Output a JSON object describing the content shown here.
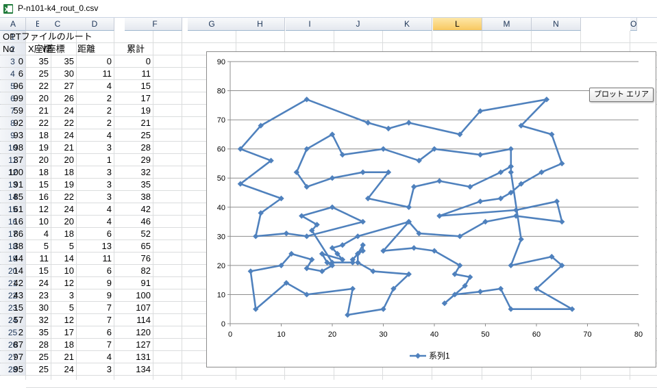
{
  "window": {
    "title": "P-n101-k4_rout_0.csv"
  },
  "columns": [
    "A",
    "B",
    "C",
    "D",
    "E",
    "F",
    "G",
    "H",
    "I",
    "J",
    "K",
    "L",
    "M",
    "N",
    "O"
  ],
  "selected_column": "L",
  "rows": [
    [
      "OPTファイルのルート",
      "",
      "",
      "",
      ""
    ],
    [
      "No",
      "X座標",
      "Y座標",
      "距離",
      "累計"
    ],
    [
      "0",
      "35",
      "35",
      "0",
      "0"
    ],
    [
      "6",
      "25",
      "30",
      "11",
      "11"
    ],
    [
      "96",
      "22",
      "27",
      "4",
      "15"
    ],
    [
      "99",
      "20",
      "26",
      "2",
      "17"
    ],
    [
      "59",
      "21",
      "24",
      "2",
      "19"
    ],
    [
      "92",
      "22",
      "22",
      "2",
      "21"
    ],
    [
      "93",
      "18",
      "24",
      "4",
      "25"
    ],
    [
      "98",
      "19",
      "21",
      "3",
      "28"
    ],
    [
      "37",
      "20",
      "20",
      "1",
      "29"
    ],
    [
      "100",
      "18",
      "18",
      "3",
      "32"
    ],
    [
      "91",
      "15",
      "19",
      "3",
      "35"
    ],
    [
      "85",
      "16",
      "22",
      "3",
      "38"
    ],
    [
      "61",
      "12",
      "24",
      "4",
      "42"
    ],
    [
      "16",
      "10",
      "20",
      "4",
      "46"
    ],
    [
      "86",
      "4",
      "18",
      "6",
      "52"
    ],
    [
      "38",
      "5",
      "5",
      "13",
      "65"
    ],
    [
      "44",
      "11",
      "14",
      "11",
      "76"
    ],
    [
      "14",
      "15",
      "10",
      "6",
      "82"
    ],
    [
      "42",
      "24",
      "12",
      "9",
      "91"
    ],
    [
      "43",
      "23",
      "3",
      "9",
      "100"
    ],
    [
      "15",
      "30",
      "5",
      "7",
      "107"
    ],
    [
      "57",
      "32",
      "12",
      "7",
      "114"
    ],
    [
      "2",
      "35",
      "17",
      "6",
      "120"
    ],
    [
      "87",
      "28",
      "18",
      "7",
      "127"
    ],
    [
      "97",
      "25",
      "21",
      "4",
      "131"
    ],
    [
      "95",
      "25",
      "24",
      "3",
      "134"
    ]
  ],
  "row_numbers": [
    "1",
    "2",
    "3",
    "4",
    "5",
    "6",
    "7",
    "8",
    "9",
    "10",
    "11",
    "12",
    "13",
    "14",
    "15",
    "16",
    "17",
    "18",
    "19",
    "20",
    "21",
    "22",
    "23",
    "24",
    "25",
    "26",
    "27",
    "28"
  ],
  "tooltip": "プロット エリア",
  "chart_data": {
    "type": "scatter",
    "title": "",
    "xlabel": "",
    "ylabel": "",
    "xlim": [
      0,
      80
    ],
    "ylim": [
      0,
      90
    ],
    "xticks": [
      "0",
      "10",
      "20",
      "30",
      "40",
      "50",
      "60",
      "70",
      "80"
    ],
    "yticks": [
      "0",
      "10",
      "20",
      "30",
      "40",
      "50",
      "60",
      "70",
      "80",
      "90"
    ],
    "grid": "horizontal",
    "legend": "bottom",
    "color": "#4f81bd",
    "series": [
      {
        "name": "系列1",
        "points": [
          [
            35,
            35
          ],
          [
            25,
            30
          ],
          [
            22,
            27
          ],
          [
            20,
            26
          ],
          [
            21,
            24
          ],
          [
            22,
            22
          ],
          [
            18,
            24
          ],
          [
            19,
            21
          ],
          [
            20,
            20
          ],
          [
            18,
            18
          ],
          [
            15,
            19
          ],
          [
            16,
            22
          ],
          [
            12,
            24
          ],
          [
            10,
            20
          ],
          [
            4,
            18
          ],
          [
            5,
            5
          ],
          [
            11,
            14
          ],
          [
            15,
            10
          ],
          [
            24,
            12
          ],
          [
            23,
            3
          ],
          [
            30,
            5
          ],
          [
            32,
            12
          ],
          [
            35,
            17
          ],
          [
            28,
            18
          ],
          [
            25,
            21
          ],
          [
            25,
            24
          ],
          [
            26,
            27
          ],
          [
            26,
            25
          ],
          [
            25,
            24
          ],
          [
            24,
            22
          ],
          [
            24,
            21
          ],
          [
            20,
            21
          ],
          [
            16,
            32
          ],
          [
            17,
            34
          ],
          [
            14,
            37
          ],
          [
            20,
            40
          ],
          [
            26,
            35
          ],
          [
            15,
            30
          ],
          [
            11,
            31
          ],
          [
            5,
            30
          ],
          [
            6,
            38
          ],
          [
            10,
            43
          ],
          [
            2,
            48
          ],
          [
            8,
            56
          ],
          [
            2,
            60
          ],
          [
            6,
            68
          ],
          [
            15,
            77
          ],
          [
            27,
            69
          ],
          [
            31,
            67
          ],
          [
            35,
            69
          ],
          [
            45,
            65
          ],
          [
            49,
            73
          ],
          [
            62,
            77
          ],
          [
            57,
            68
          ],
          [
            63,
            65
          ],
          [
            65,
            55
          ],
          [
            61,
            52
          ],
          [
            57,
            48
          ],
          [
            55,
            45
          ],
          [
            53,
            43
          ],
          [
            49,
            42
          ],
          [
            41,
            37
          ],
          [
            56,
            39
          ],
          [
            64,
            42
          ],
          [
            65,
            35
          ],
          [
            56,
            37
          ],
          [
            50,
            35
          ],
          [
            45,
            30
          ],
          [
            37,
            31
          ],
          [
            35,
            35
          ],
          [
            30,
            25
          ],
          [
            36,
            26
          ],
          [
            40,
            25
          ],
          [
            45,
            20
          ],
          [
            44,
            17
          ],
          [
            47,
            16
          ],
          [
            46,
            13
          ],
          [
            42,
            7
          ],
          [
            44,
            10
          ],
          [
            49,
            11
          ],
          [
            53,
            12
          ],
          [
            55,
            5
          ],
          [
            67,
            5
          ],
          [
            60,
            12
          ],
          [
            65,
            20
          ],
          [
            63,
            23
          ],
          [
            55,
            20
          ],
          [
            57,
            29
          ],
          [
            55,
            52
          ],
          [
            55,
            54
          ],
          [
            55,
            60
          ],
          [
            49,
            58
          ],
          [
            40,
            60
          ],
          [
            37,
            56
          ],
          [
            30,
            60
          ],
          [
            22,
            58
          ],
          [
            20,
            65
          ],
          [
            15,
            60
          ],
          [
            13,
            52
          ],
          [
            15,
            47
          ],
          [
            20,
            50
          ],
          [
            26,
            52
          ],
          [
            31,
            52
          ],
          [
            27,
            43
          ],
          [
            35,
            40
          ],
          [
            36,
            47
          ],
          [
            41,
            49
          ],
          [
            47,
            47
          ],
          [
            53,
            52
          ],
          [
            55,
            54
          ]
        ]
      }
    ]
  }
}
